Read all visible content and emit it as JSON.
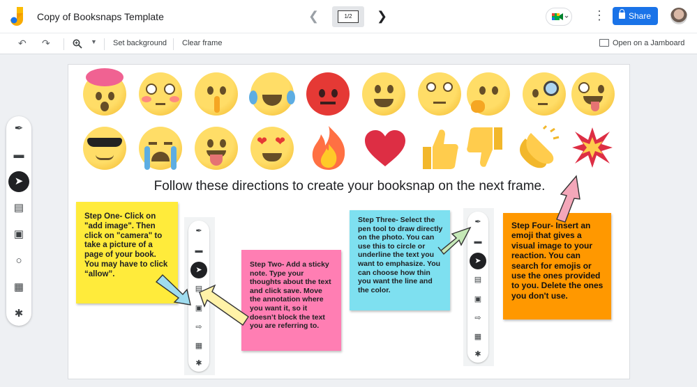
{
  "header": {
    "doc_title": "Copy of Booksnaps Template",
    "frame_indicator": "1/2",
    "share_label": "Share",
    "icons": [
      "jamboard-logo-icon",
      "chevron-left-icon",
      "chevron-right-icon",
      "meet-icon",
      "more-vert-icon",
      "lock-icon",
      "avatar"
    ]
  },
  "toolbar": {
    "set_background": "Set background",
    "clear_frame": "Clear frame",
    "open_jamboard": "Open on a Jamboard",
    "icons": [
      "undo-icon",
      "redo-icon",
      "zoom-icon",
      "dropdown-icon",
      "cast-icon"
    ]
  },
  "rail": {
    "tools": [
      "pen-icon",
      "eraser-icon",
      "select-icon",
      "sticky-note-icon",
      "image-icon",
      "circle-icon",
      "text-box-icon",
      "laser-icon"
    ],
    "active_tool": "select-icon"
  },
  "canvas": {
    "directions": "Follow these directions to create your booksnap on the next frame.",
    "notes": {
      "step1": "Step One- Click on \"add image\". Then click on \"camera\" to take a picture of a page of your book. You may have to click “allow”.",
      "step2": "Step Two- Add a sticky note. Type your thoughts about the text and click save. Move the annotation where you want it, so it doesn’t block the text you are referring to.",
      "step3": "Step Three- Select the pen tool to draw directly on the photo. You can use this to circle or underline the text you want to emphasize. You can choose how thin you want the line and the color.",
      "step4": "Step Four- Insert an emoji that gives a visual image to your reaction. You can search for emojis or use the ones provided to you. Delete the ones you don't use."
    },
    "emojis_row1": [
      "mind-blown-emoji",
      "flushed-emoji",
      "shushing-emoji",
      "joy-tears-emoji",
      "angry-emoji",
      "grinning-emoji",
      "eye-roll-emoji",
      "thinking-emoji",
      "monocle-emoji",
      "zany-emoji"
    ],
    "emojis_row2": [
      "sunglasses-emoji",
      "crying-emoji",
      "tongue-emoji",
      "heart-eyes-emoji",
      "fire-emoji",
      "red-heart-emoji",
      "thumbs-up-emoji",
      "thumbs-down-emoji",
      "clapping-emoji",
      "collision-emoji"
    ]
  },
  "colors": {
    "share_blue": "#1a73e8",
    "note_yellow": "#ffeb3b",
    "note_pink": "#ff7eb3",
    "note_cyan": "#7ee0f0",
    "note_orange": "#ff9800",
    "arrow_blue": "#9fdcef",
    "arrow_yellow": "#fff2a8",
    "arrow_green": "#c5e8b7",
    "arrow_pink": "#f4a7b9"
  }
}
